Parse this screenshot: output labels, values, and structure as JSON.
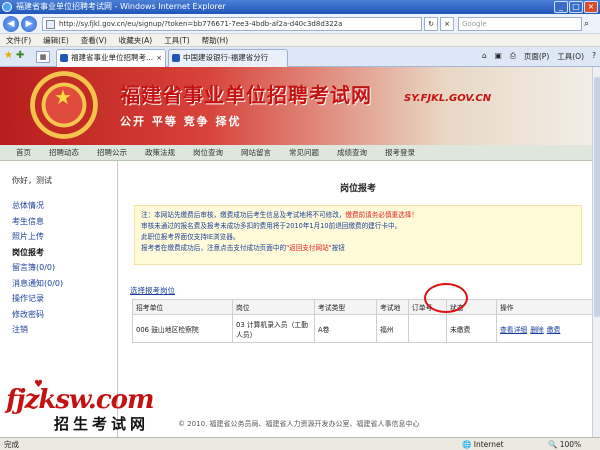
{
  "window": {
    "title": "福建省事业单位招聘考试网 - Windows Internet Explorer",
    "controls": [
      "_",
      "□",
      "×"
    ]
  },
  "address": {
    "url": "http://sy.fjkl.gov.cn/eu/signup/?token=bb776671-7ee3-4bdb-af2a-d40c3d8d322a",
    "search_placeholder": "Google"
  },
  "menu": [
    "文件(F)",
    "编辑(E)",
    "查看(V)",
    "收藏夹(A)",
    "工具(T)",
    "帮助(H)"
  ],
  "tabs": {
    "active": "福建省事业单位招聘考...",
    "inactive": "中国建设银行-福建省分行"
  },
  "commands": {
    "home": "⌂",
    "rss": "▣",
    "print": "⎙",
    "page": "页面(P)",
    "tools": "工具(O)",
    "help": "?"
  },
  "site": {
    "title": "福建省事业单位招聘考试网",
    "slogan": "公开 平等 竞争 择优",
    "url": "SY.FJKL.GOV.CN"
  },
  "nav": [
    "首页",
    "招聘动态",
    "招聘公示",
    "政策法规",
    "岗位查询",
    "网站留言",
    "常见问题",
    "成绩查询",
    "报考登录"
  ],
  "sidebar": {
    "greeting": "你好，测试",
    "items": [
      "总体情况",
      "考生信息",
      "照片上传",
      "岗位报考",
      "留言簿(0/0)",
      "消息通知(0/0)",
      "操作记录",
      "修改密码",
      "注销"
    ]
  },
  "content": {
    "title": "岗位报考",
    "notice": {
      "line1a": "注：本网站先缴费后审核，缴费成功后考生信息及考试地将不可修改，",
      "line1b": "缴费前请务必慎重选择！",
      "line2": "审核未通过的报名费及报考未成功多扣的费用将于2010年1月10前退回缴费的建行卡中。",
      "line3": "此职位报考界面仅支持IE浏览器。",
      "line4a": "报考者在缴费成功后，注意点击支付成功页面中的",
      "line4b": "\"返回支付网站\"",
      "line4c": "按钮"
    },
    "select_link": "选择报考岗位",
    "table": {
      "headers": [
        "招考单位",
        "岗位",
        "考试类型",
        "考试地",
        "订单号",
        "状态",
        "操作"
      ],
      "rows": [
        {
          "unit": "006 鼓山地区检察院",
          "position": "03 计算机录入员（工勤人员）",
          "exam_type": "A卷",
          "exam_place": "福州",
          "order_no": "",
          "status": "未缴费",
          "actions": [
            "查看详细",
            "删除",
            "缴费"
          ]
        }
      ]
    }
  },
  "watermark": {
    "logo": "fjzksw.com",
    "text": "招生考试网"
  },
  "footer": "© 2010. 福建省公务员局、福建省人力资源开发办公室、福建省人事信息中心",
  "status": {
    "left": "完成",
    "zone": "Internet",
    "zoom": "100%"
  }
}
